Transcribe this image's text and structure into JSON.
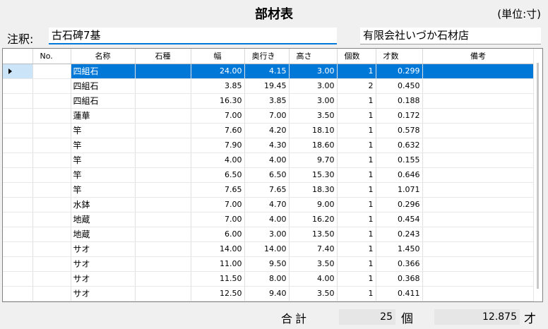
{
  "header": {
    "title": "部材表",
    "unit_label": "(単位:寸)"
  },
  "note": {
    "label": "注釈:",
    "value": "古石碑7基"
  },
  "company": {
    "value": "有限会社いづか石材店"
  },
  "grid": {
    "columns": [
      "No.",
      "名称",
      "石種",
      "幅",
      "奥行き",
      "高さ",
      "個数",
      "才数",
      "備考"
    ],
    "rows": [
      {
        "no": "",
        "name": "四組石",
        "stone": "",
        "width": "24.00",
        "depth": "4.15",
        "height": "3.00",
        "count": "1",
        "sai": "0.299",
        "note": ""
      },
      {
        "no": "",
        "name": "四組石",
        "stone": "",
        "width": "3.85",
        "depth": "19.45",
        "height": "3.00",
        "count": "2",
        "sai": "0.450",
        "note": ""
      },
      {
        "no": "",
        "name": "四組石",
        "stone": "",
        "width": "16.30",
        "depth": "3.85",
        "height": "3.00",
        "count": "1",
        "sai": "0.188",
        "note": ""
      },
      {
        "no": "",
        "name": "蓮華",
        "stone": "",
        "width": "7.00",
        "depth": "7.00",
        "height": "3.50",
        "count": "1",
        "sai": "0.172",
        "note": ""
      },
      {
        "no": "",
        "name": "竿",
        "stone": "",
        "width": "7.60",
        "depth": "4.20",
        "height": "18.10",
        "count": "1",
        "sai": "0.578",
        "note": ""
      },
      {
        "no": "",
        "name": "竿",
        "stone": "",
        "width": "7.90",
        "depth": "4.30",
        "height": "18.60",
        "count": "1",
        "sai": "0.632",
        "note": ""
      },
      {
        "no": "",
        "name": "竿",
        "stone": "",
        "width": "4.00",
        "depth": "4.00",
        "height": "9.70",
        "count": "1",
        "sai": "0.155",
        "note": ""
      },
      {
        "no": "",
        "name": "竿",
        "stone": "",
        "width": "6.50",
        "depth": "6.50",
        "height": "15.30",
        "count": "1",
        "sai": "0.646",
        "note": ""
      },
      {
        "no": "",
        "name": "竿",
        "stone": "",
        "width": "7.65",
        "depth": "7.65",
        "height": "18.30",
        "count": "1",
        "sai": "1.071",
        "note": ""
      },
      {
        "no": "",
        "name": "水鉢",
        "stone": "",
        "width": "7.00",
        "depth": "4.70",
        "height": "9.00",
        "count": "1",
        "sai": "0.296",
        "note": ""
      },
      {
        "no": "",
        "name": "地蔵",
        "stone": "",
        "width": "7.00",
        "depth": "4.00",
        "height": "16.20",
        "count": "1",
        "sai": "0.454",
        "note": ""
      },
      {
        "no": "",
        "name": "地蔵",
        "stone": "",
        "width": "6.00",
        "depth": "3.00",
        "height": "13.50",
        "count": "1",
        "sai": "0.243",
        "note": ""
      },
      {
        "no": "",
        "name": "サオ",
        "stone": "",
        "width": "14.00",
        "depth": "14.00",
        "height": "7.40",
        "count": "1",
        "sai": "1.450",
        "note": ""
      },
      {
        "no": "",
        "name": "サオ",
        "stone": "",
        "width": "11.00",
        "depth": "9.50",
        "height": "3.50",
        "count": "1",
        "sai": "0.366",
        "note": ""
      },
      {
        "no": "",
        "name": "サオ",
        "stone": "",
        "width": "11.50",
        "depth": "8.00",
        "height": "4.00",
        "count": "1",
        "sai": "0.368",
        "note": ""
      },
      {
        "no": "",
        "name": "サオ",
        "stone": "",
        "width": "12.50",
        "depth": "9.40",
        "height": "3.50",
        "count": "1",
        "sai": "0.411",
        "note": ""
      }
    ]
  },
  "footer": {
    "total_label": "合計",
    "count_value": "25",
    "count_unit": "個",
    "sai_value": "12.875",
    "sai_unit": "才"
  },
  "colors": {
    "selection": "#0078d7",
    "row_header_selected": "#cce4f7"
  }
}
